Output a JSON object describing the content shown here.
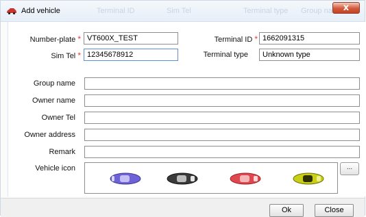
{
  "window": {
    "title": "Add vehicle",
    "close_glyph": "x",
    "ghost_headers": [
      "Terminal ID",
      "Sim Tel",
      "Terminal type",
      "Group name"
    ]
  },
  "form": {
    "number_plate": {
      "label": "Number-plate",
      "required_mark": "*",
      "value": "VT600X_TEST"
    },
    "terminal_id": {
      "label": "Terminal ID",
      "required_mark": "*",
      "value": "1662091315"
    },
    "sim_tel": {
      "label": "Sim Tel",
      "required_mark": "*",
      "value": "12345678912"
    },
    "terminal_type": {
      "label": "Terminal type",
      "value": "Unknown type"
    },
    "group_name": {
      "label": "Group name",
      "value": ""
    },
    "owner_name": {
      "label": "Owner name",
      "value": ""
    },
    "owner_tel": {
      "label": "Owner Tel",
      "value": ""
    },
    "owner_address": {
      "label": "Owner address",
      "value": ""
    },
    "remark": {
      "label": "Remark",
      "value": ""
    },
    "vehicle_icon": {
      "label": "Vehicle icon",
      "browse_label": "...",
      "icons": [
        {
          "name": "car-blue-icon",
          "color": "#6e62d8"
        },
        {
          "name": "car-black-icon",
          "color": "#3a3a3a"
        },
        {
          "name": "car-red-icon",
          "color": "#e0484f"
        },
        {
          "name": "car-yellow-icon",
          "color": "#c9cf16"
        }
      ]
    }
  },
  "footer": {
    "ok_label": "Ok",
    "close_label": "Close"
  }
}
